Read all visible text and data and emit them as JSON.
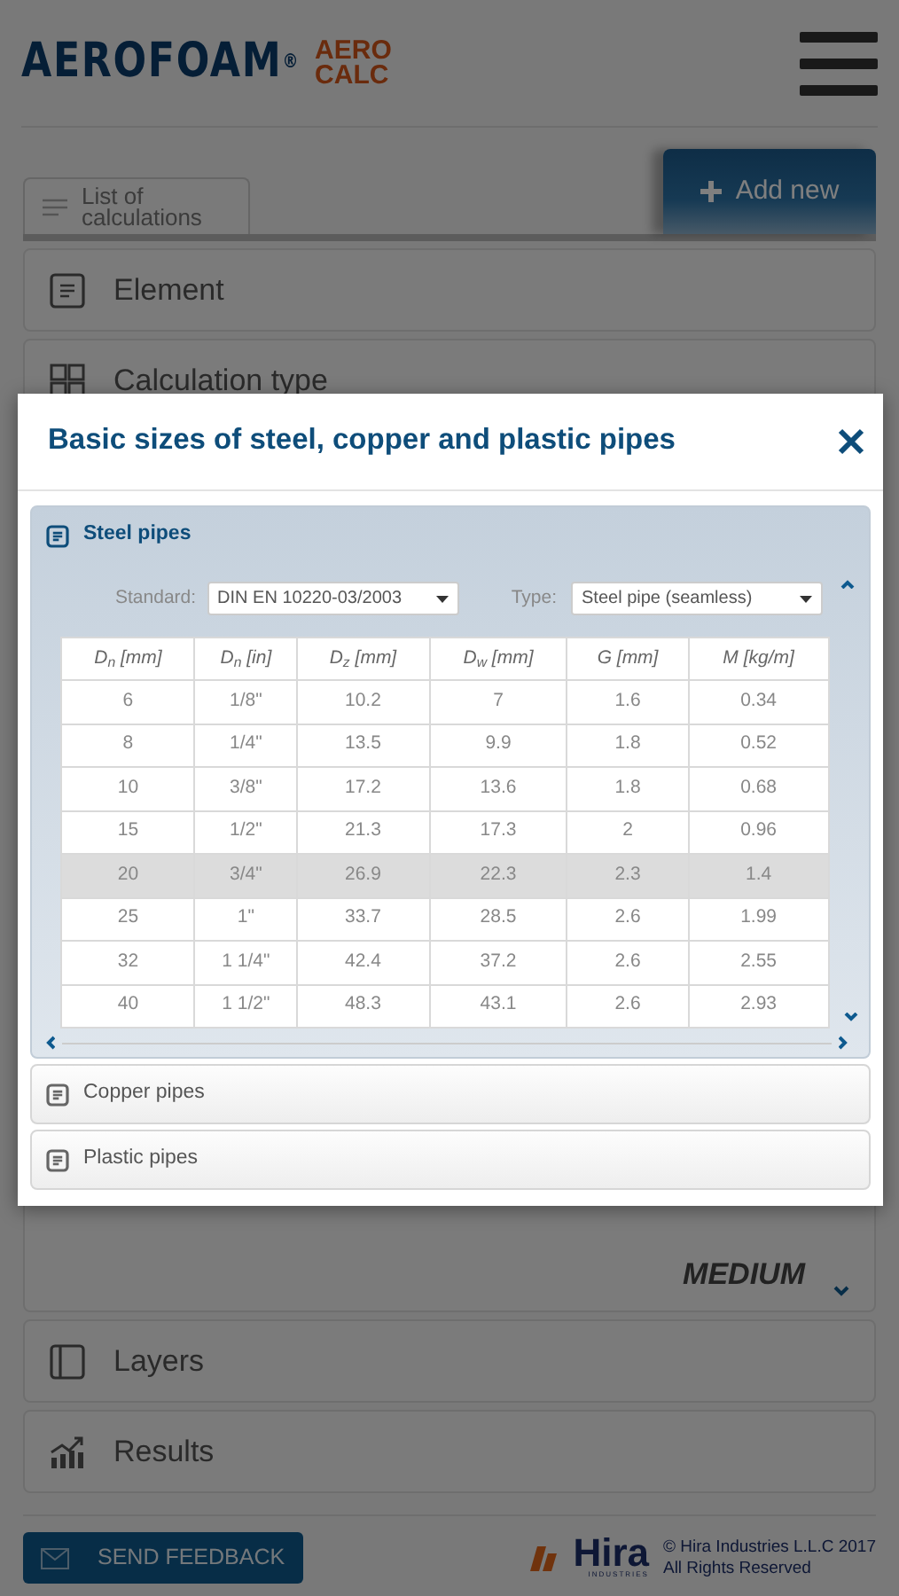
{
  "header": {
    "brand": "AEROFOAM$^{®}$",
    "app_name": [
      "AERO",
      "CALC"
    ]
  },
  "toolbar": {
    "list_button": "List of calculations",
    "add_button": "Add new"
  },
  "sections": [
    {
      "kind": "panel",
      "label": "Element"
    },
    {
      "kind": "panel",
      "label": "Calculation type"
    },
    {
      "kind": "value",
      "value": "MEDIUM"
    },
    {
      "kind": "panel",
      "label": "Layers"
    },
    {
      "kind": "panel",
      "label": "Results"
    }
  ],
  "modal": {
    "title": "Basic sizes of steel, copper and plastic pipes",
    "accordion": [
      {
        "title": "Steel pipes",
        "expanded": true,
        "filters": [
          {
            "label": "Standard:",
            "value": "DIN EN 10220-03/2003"
          },
          {
            "label": "Type:",
            "value": "Steel pipe (seamless)"
          }
        ],
        "table": {
          "columns": [
            "D$_{n}$ [mm]",
            "D$_{n}$ [in]",
            "D$_{z}$ [mm]",
            "D$_{w}$ [mm]",
            "G [mm]",
            "M [kg/m]"
          ],
          "rows": [
            {
              "cells": [
                "6",
                "1/8\"",
                "10.2",
                "7",
                "1.6",
                "0.34"
              ],
              "selected": false
            },
            {
              "cells": [
                "8",
                "1/4\"",
                "13.5",
                "9.9",
                "1.8",
                "0.52"
              ],
              "selected": false
            },
            {
              "cells": [
                "10",
                "3/8\"",
                "17.2",
                "13.6",
                "1.8",
                "0.68"
              ],
              "selected": false
            },
            {
              "cells": [
                "15",
                "1/2\"",
                "21.3",
                "17.3",
                "2",
                "0.96"
              ],
              "selected": false
            },
            {
              "cells": [
                "20",
                "3/4\"",
                "26.9",
                "22.3",
                "2.3",
                "1.4"
              ],
              "selected": true
            },
            {
              "cells": [
                "25",
                "1\"",
                "33.7",
                "28.5",
                "2.6",
                "1.99"
              ],
              "selected": false
            },
            {
              "cells": [
                "32",
                "1 1/4\"",
                "42.4",
                "37.2",
                "2.6",
                "2.55"
              ],
              "selected": false
            },
            {
              "cells": [
                "40",
                "1 1/2\"",
                "48.3",
                "43.1",
                "2.6",
                "2.93"
              ],
              "selected": false
            }
          ]
        }
      },
      {
        "title": "Copper pipes",
        "expanded": false
      },
      {
        "title": "Plastic pipes",
        "expanded": false
      }
    ]
  },
  "footer": {
    "feedback_button": "SEND FEEDBACK",
    "company_logo": {
      "name": "Hira",
      "sub": "INDUSTRIES"
    },
    "copyright": [
      "© Hira Industries L.L.C 2017",
      "All Rights Reserved"
    ]
  }
}
